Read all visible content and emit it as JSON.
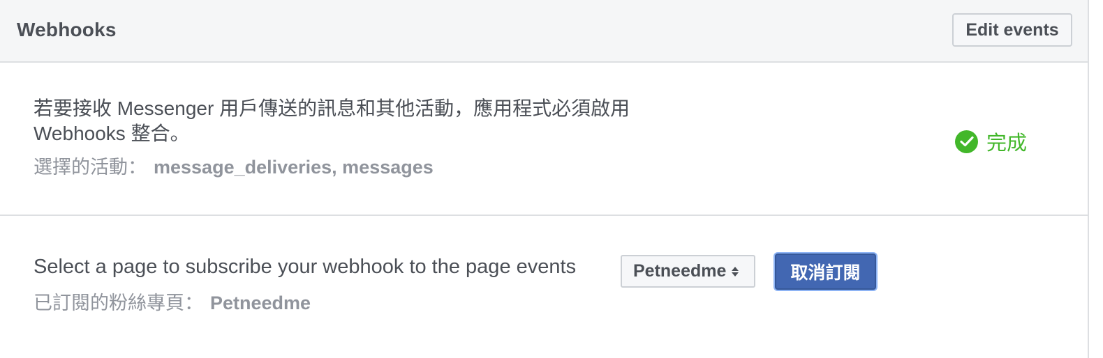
{
  "header": {
    "title": "Webhooks",
    "edit_events_label": "Edit events"
  },
  "webhook_status": {
    "description": "若要接收 Messenger 用戶傳送的訊息和其他活動，應用程式必須啟用 Webhooks 整合。",
    "selected_events_label": "選擇的活動：",
    "selected_events_value": "message_deliveries, messages",
    "status_icon": "check-circle-icon",
    "status_text": "完成",
    "status_color": "#42b72a"
  },
  "page_subscription": {
    "prompt": "Select a page to subscribe your webhook to the page events",
    "subscribed_label": "已訂閱的粉絲專頁：",
    "subscribed_value": "Petneedme",
    "page_select_value": "Petneedme",
    "unsubscribe_label": "取消訂閱",
    "unsubscribe_color": "#4267b2"
  }
}
